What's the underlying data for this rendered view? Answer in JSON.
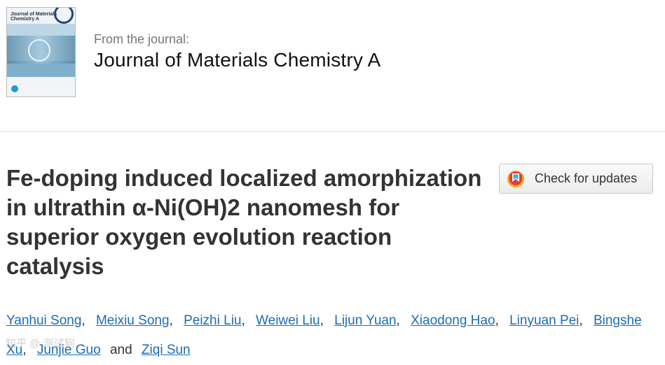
{
  "journal": {
    "cover_title": "Journal of Materials Chemistry A",
    "from_label": "From the journal:",
    "name": "Journal of Materials Chemistry A"
  },
  "article": {
    "title": "Fe-doping induced localized amorphization in ultrathin α-Ni(OH)2 nanomesh for superior oxygen evolution reaction catalysis"
  },
  "check_updates": {
    "label": "Check for updates",
    "icon": "crossmark-icon",
    "colors": [
      "#f6a623",
      "#e23b3b",
      "#3bb0d8"
    ]
  },
  "authors": {
    "list": [
      "Yanhui Song",
      "Meixiu Song",
      "Peizhi Liu",
      "Weiwei Liu",
      "Lijun Yuan",
      "Xiaodong Hao",
      "Linyuan Pei",
      "Bingshe Xu",
      "Junjie Guo",
      "Ziqi Sun"
    ],
    "conjunction": "and",
    "link_color": "#1a6db3"
  },
  "watermark": "知乎 @ 测试狗"
}
